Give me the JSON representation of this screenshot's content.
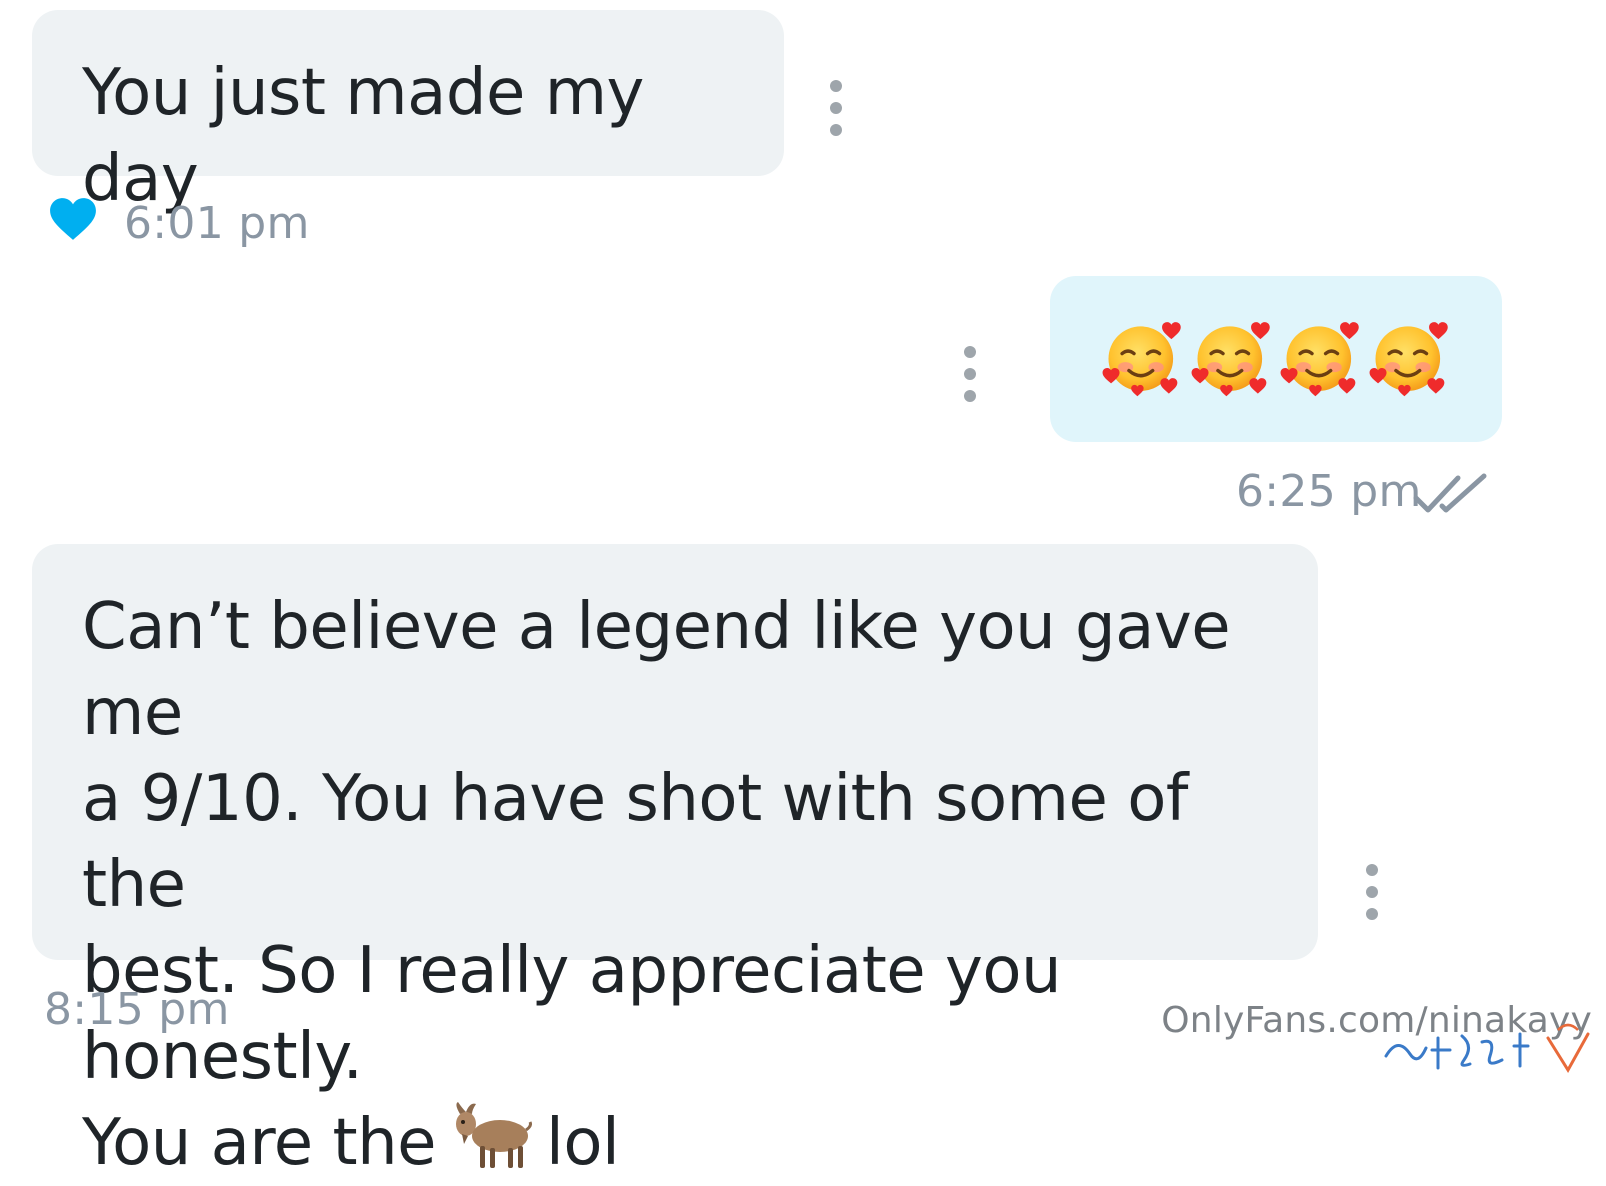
{
  "messages": [
    {
      "direction": "incoming",
      "text": "You just made my day",
      "time": "6:01 pm",
      "liked": true
    },
    {
      "direction": "outgoing",
      "emoji": [
        "smiling-face-with-hearts",
        "smiling-face-with-hearts",
        "smiling-face-with-hearts",
        "smiling-face-with-hearts"
      ],
      "time": "6:25 pm",
      "read": true
    },
    {
      "direction": "incoming",
      "lines": [
        "Can’t believe a legend like you gave me",
        "a 9/10. You have shot with some of the",
        "best. So I really appreciate you honestly."
      ],
      "last_line_before": "You are the",
      "last_line_emoji": "goat-emoji",
      "last_line_after": "lol",
      "time": "8:15 pm"
    }
  ],
  "watermark": "OnlyFans.com/ninakayy",
  "signature": "Best Not",
  "icons": {
    "menu": "vertical-ellipsis-icon",
    "like": "heart-icon",
    "read_receipt": "double-check-icon"
  },
  "colors": {
    "incoming_bubble": "#eef2f4",
    "outgoing_bubble": "#e0f5fb",
    "heart": "#00aff0",
    "timestamp": "#8a96a3"
  }
}
